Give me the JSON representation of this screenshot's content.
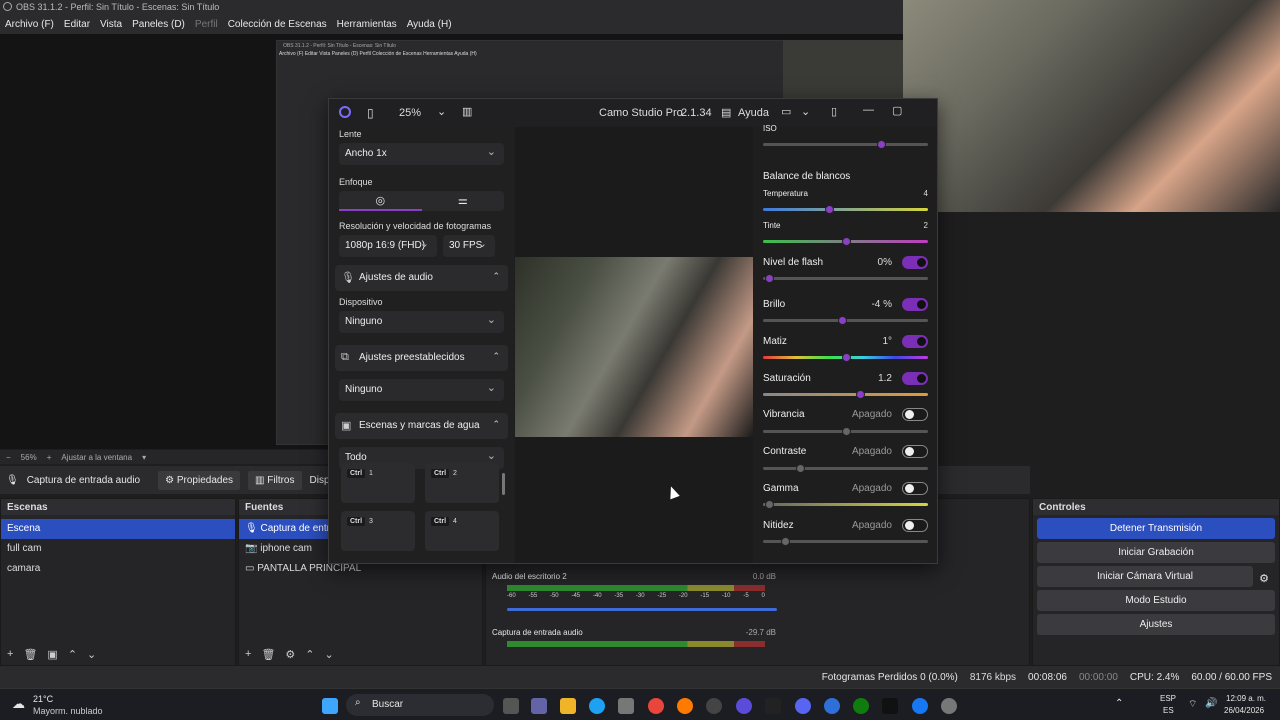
{
  "obs": {
    "title": "OBS 31.1.2 - Perfil: Sin Título - Escenas: Sin Título",
    "menu": [
      {
        "label": "Archivo (F)",
        "enabled": true
      },
      {
        "label": "Editar",
        "enabled": true
      },
      {
        "label": "Vista",
        "enabled": true
      },
      {
        "label": "Paneles (D)",
        "enabled": true
      },
      {
        "label": "Perfil",
        "enabled": false
      },
      {
        "label": "Colección de Escenas",
        "enabled": true
      },
      {
        "label": "Herramientas",
        "enabled": true
      },
      {
        "label": "Ayuda (H)",
        "enabled": true
      }
    ],
    "zoom": {
      "value": "56%",
      "fit": "Ajustar a la ventana"
    },
    "source_bar": {
      "source": "Captura de entrada audio",
      "properties": "Propiedades",
      "filters": "Filtros",
      "devices": "Dispositi"
    },
    "scenes": {
      "title": "Escenas",
      "items": [
        "Escena",
        "full cam",
        "camara"
      ],
      "selected": 0
    },
    "sources": {
      "title": "Fuentes",
      "items": [
        {
          "label": "Captura de entra",
          "icon": "microphone-icon"
        },
        {
          "label": "iphone cam",
          "icon": "camera-icon"
        },
        {
          "label": "PANTALLA PRINCIPAL",
          "icon": "monitor-icon"
        }
      ]
    },
    "mixer": [
      {
        "name": "Audio del escritorio 2",
        "db": "0.0 dB"
      },
      {
        "name": "Captura de entrada audio",
        "db": "-29.7 dB"
      }
    ],
    "meter_ticks": [
      "-60",
      "-55",
      "-50",
      "-45",
      "-40",
      "-35",
      "-30",
      "-25",
      "-20",
      "-15",
      "-10",
      "-5",
      "0"
    ],
    "controls": {
      "title": "Controles",
      "buttons": [
        "Detener Transmisión",
        "Iniciar Grabación",
        "Iniciar Cámara Virtual",
        "Modo Estudio",
        "Ajustes"
      ]
    },
    "status": {
      "dropped": "Fotogramas Perdidos 0 (0.0%)",
      "bitrate": "8176 kbps",
      "stream_time": "00:08:06",
      "rec_time": "00:00:00",
      "cpu": "CPU: 2.4%",
      "fps": "60.00 / 60.00 FPS"
    }
  },
  "nested_preview": {
    "title": "OBS 31.1.2 - Perfil: Sin Título - Escenas: Sin Título",
    "menu": "Archivo (F)   Editar   Vista   Paneles (D)   Perfil   Colección de Escenas   Herramientas   Ayuda (H)"
  },
  "camo": {
    "zoom": "25%",
    "app_name": "Camo Studio Pro",
    "version": "2.1.34",
    "help": "Ayuda",
    "lens_label": "Lente",
    "lens_value": "Ancho 1x",
    "focus_label": "Enfoque",
    "res_label": "Resolución y velocidad de fotogramas",
    "res_value": "1080p 16:9 (FHD)",
    "fps_value": "30 FPS",
    "audio_title": "Ajustes de audio",
    "device_label": "Dispositivo",
    "device_value": "Ninguno",
    "presets_title": "Ajustes preestablecidos",
    "presets_value": "Ninguno",
    "scenes_title": "Escenas y marcas de agua",
    "scenes_filter": "Todo",
    "tiles": [
      {
        "key": "Ctrl",
        "num": "1"
      },
      {
        "key": "Ctrl",
        "num": "2"
      },
      {
        "key": "Ctrl",
        "num": "3"
      },
      {
        "key": "Ctrl",
        "num": "4"
      }
    ],
    "adjust": {
      "iso": "ISO",
      "wb_title": "Balance de blancos",
      "temp_label": "Temperatura",
      "temp_value": "4",
      "tint_label": "Tinte",
      "tint_value": "2",
      "flash_label": "Nivel de flash",
      "flash_value": "0%",
      "bright_label": "Brillo",
      "bright_value": "-4 %",
      "hue_label": "Matiz",
      "hue_value": "1°",
      "sat_label": "Saturación",
      "sat_value": "1.2",
      "vib_label": "Vibrancia",
      "contrast_label": "Contraste",
      "gamma_label": "Gamma",
      "sharp_label": "Nitidez",
      "off": "Apagado"
    }
  },
  "taskbar": {
    "weather_temp": "21°C",
    "weather_desc": "Mayorm. nublado",
    "search": "Buscar",
    "lang1": "ESP",
    "lang2": "ES",
    "time": "12:09 a. m.",
    "date": "26/04/2026"
  },
  "colors": {
    "accent": "#2c4fbf",
    "camo_accent": "#7b2fb7"
  }
}
